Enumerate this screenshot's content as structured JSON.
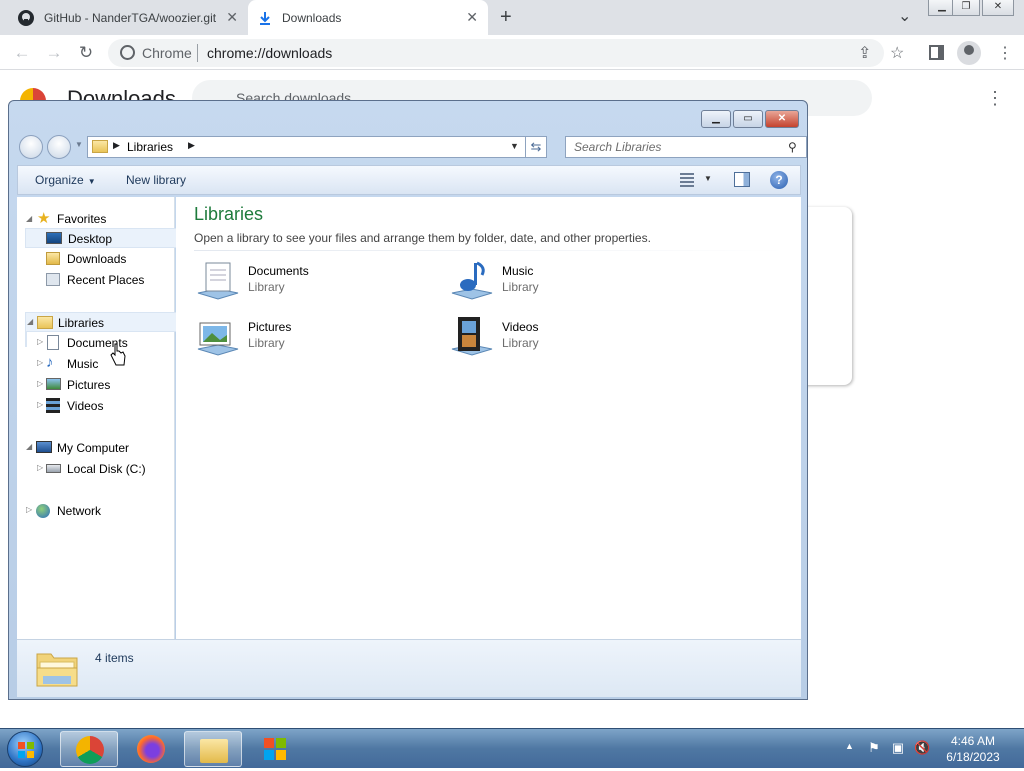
{
  "browser": {
    "tabs": [
      {
        "title": "GitHub - NanderTGA/woozier.git",
        "active": false
      },
      {
        "title": "Downloads",
        "active": true
      }
    ],
    "omnibox": {
      "site": "Chrome",
      "url": "chrome://downloads"
    }
  },
  "downloads_page": {
    "title": "Downloads",
    "search_placeholder": "Search downloads"
  },
  "explorer": {
    "address": {
      "crumb": "Libraries"
    },
    "search_placeholder": "Search Libraries",
    "commands": {
      "organize": "Organize",
      "new_library": "New library"
    },
    "nav": {
      "favorites": {
        "label": "Favorites",
        "items": [
          "Desktop",
          "Downloads",
          "Recent Places"
        ]
      },
      "libraries": {
        "label": "Libraries",
        "items": [
          "Documents",
          "Music",
          "Pictures",
          "Videos"
        ]
      },
      "computer": {
        "label": "My Computer",
        "items": [
          "Local Disk (C:)"
        ]
      },
      "network": {
        "label": "Network"
      }
    },
    "content": {
      "title": "Libraries",
      "description": "Open a library to see your files and arrange them by folder, date, and other properties.",
      "libraries": [
        {
          "name": "Documents",
          "type": "Library"
        },
        {
          "name": "Music",
          "type": "Library"
        },
        {
          "name": "Pictures",
          "type": "Library"
        },
        {
          "name": "Videos",
          "type": "Library"
        }
      ]
    },
    "status": "4 items"
  },
  "taskbar": {
    "clock": {
      "time": "4:46 AM",
      "date": "6/18/2023"
    }
  }
}
